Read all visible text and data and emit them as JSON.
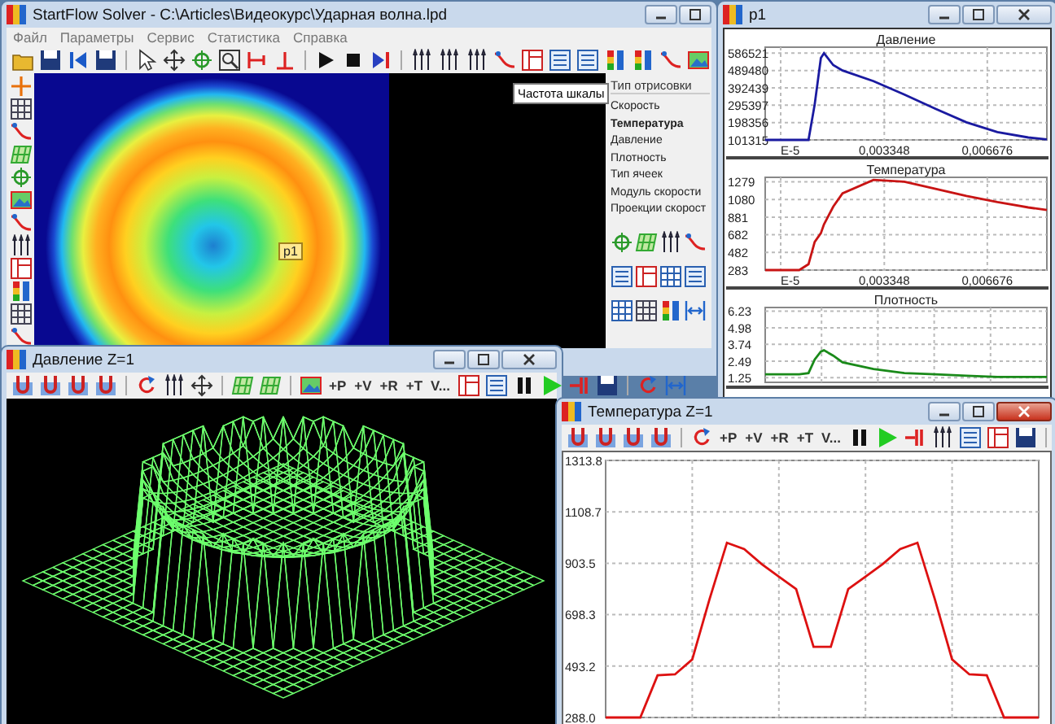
{
  "main_window": {
    "title": "StartFlow Solver - C:\\Articles\\Видеокурс\\Ударная волна.lpd",
    "menu": [
      "Файл",
      "Параметры",
      "Сервис",
      "Статистика",
      "Справка"
    ],
    "tooltip": "Частота шкалы",
    "probe_label": "p1",
    "display_type": {
      "title": "Тип отрисовки",
      "items": [
        {
          "label": "Скорость",
          "selected": false
        },
        {
          "label": "Температура",
          "selected": true
        },
        {
          "label": "Давление",
          "selected": false
        },
        {
          "label": "Плотность",
          "selected": false
        },
        {
          "label": "Тип ячеек",
          "selected": false
        },
        {
          "label": "Модуль скорости",
          "selected": false
        },
        {
          "label": "Проекции скорост",
          "selected": false
        }
      ]
    }
  },
  "probe_window": {
    "title": "p1",
    "charts": [
      {
        "chart_data": {
          "type": "line",
          "title": "Давление",
          "grid": true,
          "x": [
            -0.0005,
            0.0006,
            0.0009,
            0.0011,
            0.0013,
            0.0014,
            0.0017,
            0.002,
            0.003,
            0.004,
            0.005,
            0.006,
            0.007,
            0.008,
            0.0086
          ],
          "series": [
            {
              "color": "#1a1aa0",
              "values": [
                101315,
                101315,
                101315,
                300000,
                560000,
                586521,
                520000,
                490000,
                430000,
                355000,
                275000,
                200000,
                145000,
                115000,
                104000
              ]
            }
          ],
          "xlim": [
            -0.0005,
            0.0086
          ],
          "ylim": [
            101315,
            620000
          ],
          "xticks": [
            {
              "value": 0,
              "label": "E-5"
            },
            {
              "value": 0.003348,
              "label": "0,003348"
            },
            {
              "value": 0.006676,
              "label": "0,006676"
            }
          ],
          "yticks": [
            101315,
            198356,
            295397,
            392439,
            489480,
            586521
          ]
        }
      },
      {
        "chart_data": {
          "type": "line",
          "title": "Температура",
          "grid": true,
          "x": [
            -0.0005,
            0.0006,
            0.0009,
            0.0011,
            0.0013,
            0.0014,
            0.0017,
            0.002,
            0.003,
            0.004,
            0.005,
            0.006,
            0.007,
            0.008,
            0.0086
          ],
          "series": [
            {
              "color": "#c81414",
              "values": [
                283,
                283,
                350,
                600,
                700,
                800,
                1000,
                1150,
                1300,
                1280,
                1200,
                1120,
                1050,
                990,
                960
              ]
            }
          ],
          "xlim": [
            -0.0005,
            0.0086
          ],
          "ylim": [
            283,
            1330
          ],
          "xticks": [
            {
              "value": 0,
              "label": "E-5"
            },
            {
              "value": 0.003348,
              "label": "0,003348"
            },
            {
              "value": 0.006676,
              "label": "0,006676"
            }
          ],
          "yticks": [
            283,
            482,
            682,
            881,
            1080,
            1279
          ]
        }
      },
      {
        "chart_data": {
          "type": "line",
          "title": "Плотность",
          "grid": true,
          "x": [
            -0.0005,
            0.0006,
            0.0009,
            0.0011,
            0.0013,
            0.0014,
            0.0017,
            0.002,
            0.003,
            0.004,
            0.005,
            0.006,
            0.007,
            0.008,
            0.0086
          ],
          "series": [
            {
              "color": "#1a8a1a",
              "values": [
                1.5,
                1.5,
                1.6,
                2.6,
                3.2,
                3.3,
                2.9,
                2.4,
                1.9,
                1.6,
                1.5,
                1.4,
                1.3,
                1.3,
                1.3
              ]
            }
          ],
          "xlim": [
            -0.0005,
            0.0086
          ],
          "ylim": [
            0.9,
            6.5
          ],
          "yticks": [
            1.25,
            2.49,
            3.74,
            4.98,
            6.23
          ]
        }
      }
    ]
  },
  "pressure_window": {
    "title": "Давление Z=1",
    "text_buttons": [
      "+P",
      "+V",
      "+R",
      "+T",
      "V..."
    ]
  },
  "temperature_window": {
    "title": "Температура Z=1",
    "text_buttons": [
      "+P",
      "+V",
      "+R",
      "+T",
      "V..."
    ],
    "chart_data": {
      "type": "line",
      "grid": true,
      "categories": [
        null,
        null,
        null,
        null,
        null,
        null,
        null,
        null,
        null,
        null,
        null,
        null,
        null,
        null,
        null,
        null,
        null,
        null,
        null,
        null,
        null,
        null,
        null,
        null,
        null,
        null
      ],
      "series": [
        {
          "color": "#dd1111",
          "values": [
            288,
            288,
            288,
            456,
            460,
            520,
            760,
            985,
            960,
            900,
            850,
            800,
            570,
            570,
            800,
            850,
            900,
            960,
            985,
            760,
            520,
            460,
            456,
            288,
            288,
            288
          ]
        }
      ],
      "ylim": [
        288,
        1313.8
      ],
      "yticks": [
        {
          "value": 288,
          "label": "288.0"
        },
        {
          "value": 493.2,
          "label": "493.2"
        },
        {
          "value": 698.3,
          "label": "698.3"
        },
        {
          "value": 903.5,
          "label": "903.5"
        },
        {
          "value": 1108.7,
          "label": "1108.7"
        },
        {
          "value": 1313.8,
          "label": "1313.8"
        }
      ]
    }
  }
}
